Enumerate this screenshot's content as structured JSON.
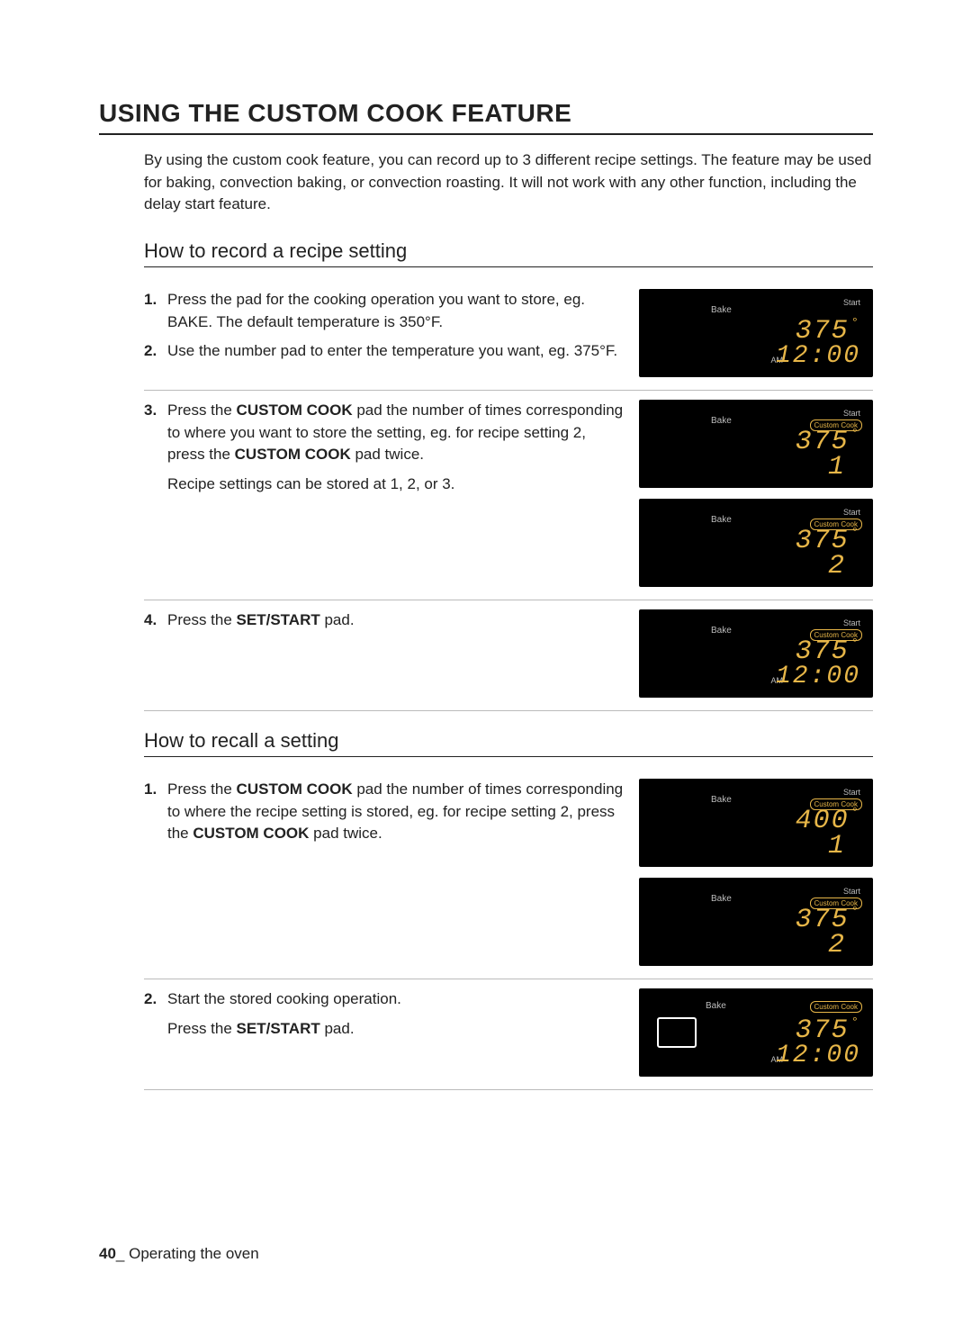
{
  "title": "USING THE CUSTOM COOK FEATURE",
  "intro": "By using the custom cook feature, you can record up to 3 different recipe settings. The feature may be used for baking, convection baking, or convection roasting. It will not work with any other function, including the delay start feature.",
  "record": {
    "heading": "How to record a recipe setting",
    "steps": {
      "s1": {
        "num": "1.",
        "text_a": "Press the pad for the cooking operation you want to store, eg. BAKE. The default temperature is 350°F."
      },
      "s2": {
        "num": "2.",
        "text_a": "Use the number pad to enter the temperature you want, eg. 375°F."
      },
      "s3": {
        "num": "3.",
        "text_a": "Press the ",
        "bold_a": "CUSTOM COOK",
        "text_b": " pad the number of times corresponding to where you want to store the setting, eg. for recipe setting 2, press the ",
        "bold_b": "CUSTOM COOK",
        "text_c": " pad twice.",
        "sub": "Recipe settings can be stored at 1, 2, or 3."
      },
      "s4": {
        "num": "4.",
        "text_a": "Press the ",
        "bold_a": "SET/START",
        "text_b": " pad."
      }
    },
    "displays": {
      "d1": {
        "bake": "Bake",
        "start": "Start",
        "temp": "375",
        "am": "AM",
        "clock": "12:00"
      },
      "d2": {
        "bake": "Bake",
        "start": "Start",
        "cc": "Custom Cook",
        "temp": "375",
        "preset": "1"
      },
      "d3": {
        "bake": "Bake",
        "start": "Start",
        "cc": "Custom Cook",
        "temp": "375",
        "preset": "2"
      },
      "d4": {
        "bake": "Bake",
        "start": "Start",
        "cc": "Custom Cook",
        "temp": "375",
        "am": "AM",
        "clock": "12:00"
      }
    }
  },
  "recall": {
    "heading": "How to recall a setting",
    "steps": {
      "s1": {
        "num": "1.",
        "text_a": "Press the ",
        "bold_a": "CUSTOM COOK",
        "text_b": " pad the number of times corresponding to where the recipe setting is stored, eg. for recipe setting 2, press the ",
        "bold_b": "CUSTOM COOK",
        "text_c": " pad twice."
      },
      "s2": {
        "num": "2.",
        "text_a": "Start the stored cooking operation.",
        "sub_a": "Press the ",
        "sub_bold": "SET/START",
        "sub_b": " pad."
      }
    },
    "displays": {
      "d1": {
        "bake": "Bake",
        "start": "Start",
        "cc": "Custom Cook",
        "temp": "400",
        "preset": "1"
      },
      "d2": {
        "bake": "Bake",
        "start": "Start",
        "cc": "Custom Cook",
        "temp": "375",
        "preset": "2"
      },
      "d3": {
        "bake": "Bake",
        "cc": "Custom Cook",
        "temp": "375",
        "am": "AM",
        "clock": "12:00"
      }
    }
  },
  "footer": {
    "page": "40",
    "sep": "_ ",
    "section": "Operating the oven"
  },
  "deg": "°"
}
